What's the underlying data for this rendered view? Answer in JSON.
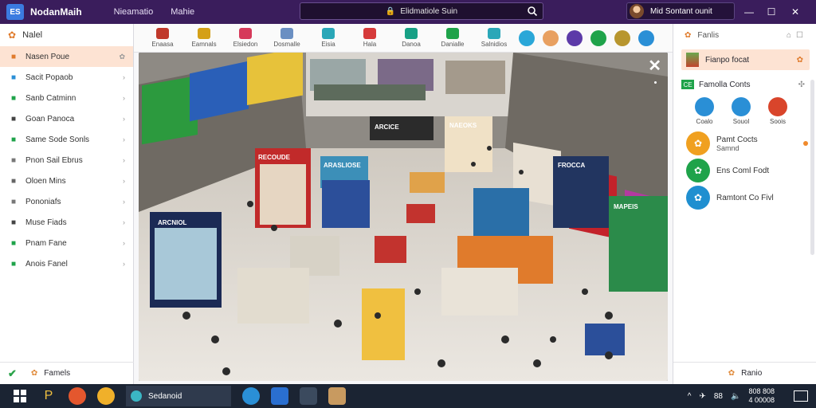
{
  "window": {
    "app_title": "NodanMaih",
    "logo_text": "ES",
    "menu": [
      "Nieamatio",
      "Mahie"
    ],
    "search_text": "Elidmatiole Suin",
    "user_name": "Mid Sontant ounit",
    "controls": [
      "—",
      "☐",
      "✕"
    ]
  },
  "sidebar": {
    "header": "Nalel",
    "items": [
      {
        "label": "Nasen Poue",
        "icon": "shop-icon",
        "color": "#e07b2c",
        "active": true
      },
      {
        "label": "Sacit Popaob",
        "icon": "monitor-icon",
        "color": "#2b8fd6"
      },
      {
        "label": "Sanb Catminn",
        "icon": "cart-icon",
        "color": "#1fa34a"
      },
      {
        "label": "Goan Panoca",
        "icon": "photo-icon",
        "color": "#444"
      },
      {
        "label": "Same Sode Sonls",
        "icon": "calendar-icon",
        "color": "#1fa34a"
      },
      {
        "label": "Pnon Sail Ebrus",
        "icon": "clock-icon",
        "color": "#777"
      },
      {
        "label": "Oloen Mins",
        "icon": "package-icon",
        "color": "#666"
      },
      {
        "label": "Pononiafs",
        "icon": "edit-icon",
        "color": "#777"
      },
      {
        "label": "Muse Fiads",
        "icon": "download-icon",
        "color": "#444"
      },
      {
        "label": "Pnam Fane",
        "icon": "leaf-icon",
        "color": "#1fa34a"
      },
      {
        "label": "Anois Fanel",
        "icon": "check-icon",
        "color": "#1fa34a"
      }
    ],
    "footer": "Famels"
  },
  "toolbar": {
    "tools": [
      {
        "label": "Enaasa",
        "icon": "home-icon",
        "color": "#c0392b"
      },
      {
        "label": "Eamnals",
        "icon": "tool-icon",
        "color": "#d4a017"
      },
      {
        "label": "Elsiedon",
        "icon": "camera-icon",
        "color": "#d63a5a"
      },
      {
        "label": "Dosmalle",
        "icon": "user-icon",
        "color": "#6a8fc2"
      },
      {
        "label": "Eisia",
        "icon": "globe-icon",
        "color": "#2aa7b8"
      },
      {
        "label": "Hala",
        "icon": "briefcase-icon",
        "color": "#d63a3a"
      },
      {
        "label": "Danoa",
        "icon": "checkmark-icon",
        "color": "#17a085"
      },
      {
        "label": "Danialle",
        "icon": "stack-icon",
        "color": "#1fa34a"
      },
      {
        "label": "Salnidios",
        "icon": "refresh-icon",
        "color": "#2aa7b8"
      }
    ],
    "round_tools": [
      {
        "icon": "om-icon",
        "color": "#2aa7d8"
      },
      {
        "icon": "face-icon",
        "color": "#e8a060"
      },
      {
        "icon": "galaxy-icon",
        "color": "#5c3aa8"
      },
      {
        "icon": "layers-icon",
        "color": "#1fa34a"
      },
      {
        "icon": "cat-icon",
        "color": "#b8962e"
      },
      {
        "icon": "target-icon",
        "color": "#2a8fd6"
      }
    ]
  },
  "viewer": {
    "close_label": "✕",
    "store_signs": [
      "ARCNIOL",
      "RECOUDE",
      "ARCICE",
      "NAEOKS",
      "FROCCA",
      "MAPEIS",
      "ARASLIOSE"
    ]
  },
  "rpanel": {
    "header": "Fanlis",
    "feature": "Fianpo focat",
    "sub_badge": "CE",
    "sub_label": "Famolla Conts",
    "apps": [
      {
        "label": "Coalo",
        "color": "#2a8fd6"
      },
      {
        "label": "Souol",
        "color": "#2a8fd6"
      },
      {
        "label": "Soois",
        "color": "#d9452b"
      }
    ],
    "rows": [
      {
        "title": "Pamt Cocts",
        "sub": "Samnd",
        "color": "#f0a020",
        "dot": true
      },
      {
        "title": "Ens Coml Fodt",
        "sub": "",
        "color": "#1fa34a",
        "dot": false
      },
      {
        "title": "Ramtont Co Fivl",
        "sub": "",
        "color": "#1f8fd0",
        "dot": false
      }
    ],
    "footer": "Ranio"
  },
  "taskbar": {
    "active_label": "Sedanoid",
    "tray_labels": [
      "^",
      "✈",
      "88",
      "🔈"
    ],
    "clock_time": "808 808",
    "clock_date": "4 00008"
  }
}
